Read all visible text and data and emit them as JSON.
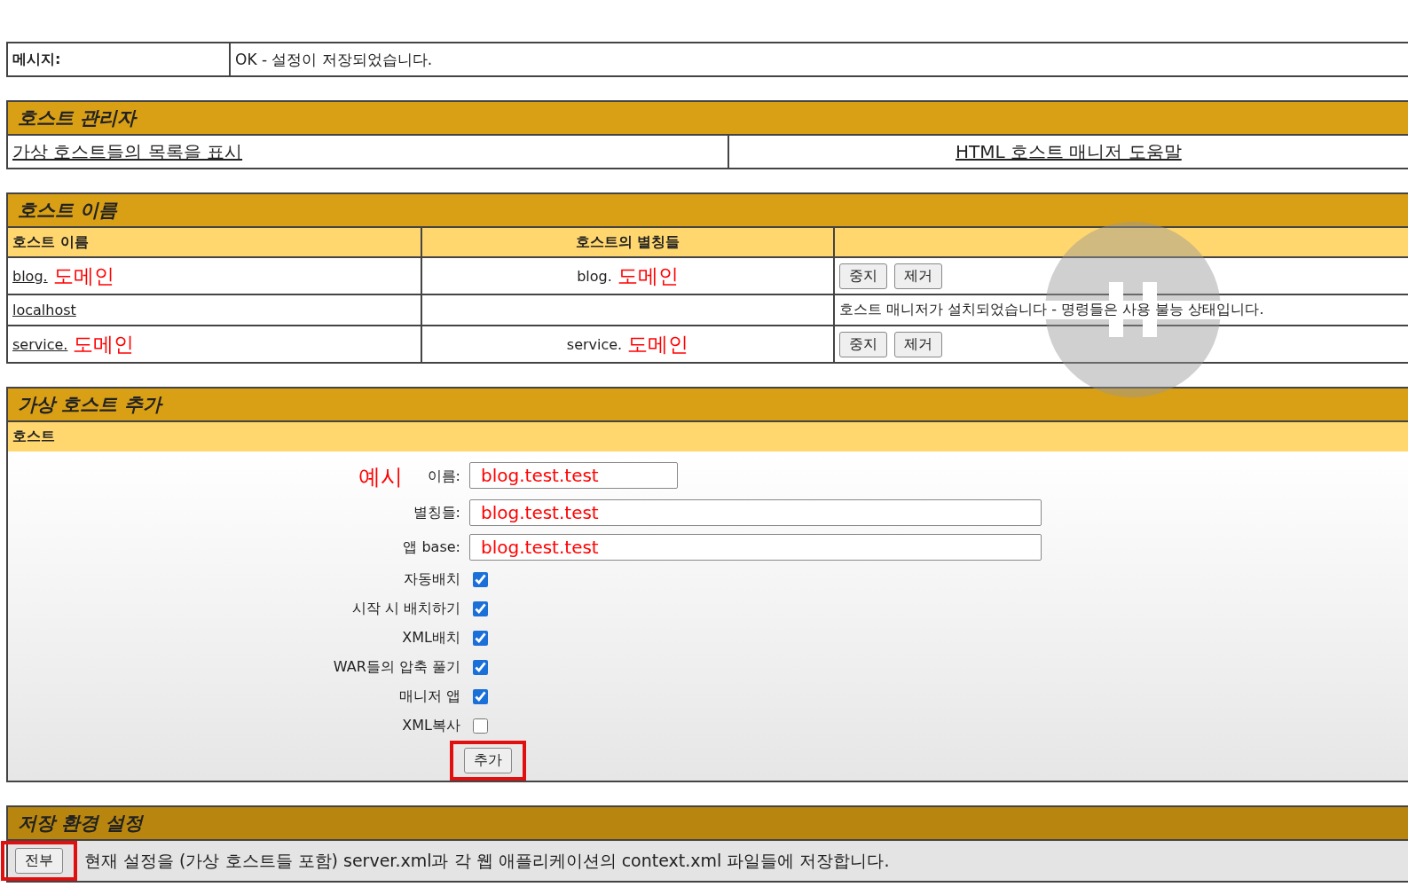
{
  "message": {
    "label": "메시지:",
    "text": "OK - 설정이 저장되었습니다."
  },
  "host_manager": {
    "title": "호스트 관리자",
    "links": [
      "가상 호스트들의 목록을 표시",
      "HTML 호스트 매니저 도움말"
    ]
  },
  "host_names": {
    "title": "호스트 이름",
    "columns": [
      "호스트 이름",
      "호스트의 별칭들"
    ],
    "rows": [
      {
        "kind": "buttons",
        "name": "blog.",
        "name_note": "도메인",
        "alias": "blog.",
        "alias_note": "도메인",
        "buttons": [
          "중지",
          "제거"
        ]
      },
      {
        "kind": "message",
        "name": "localhost",
        "message": "호스트 매니저가 설치되었습니다 - 명령들은 사용 불능 상태입니다."
      },
      {
        "kind": "buttons",
        "name": "service.",
        "name_note": "도메인",
        "alias": "service.",
        "alias_note": "도메인",
        "buttons": [
          "중지",
          "제거"
        ]
      }
    ]
  },
  "add_host": {
    "title": "가상 호스트 추가",
    "subheader": "호스트",
    "note": "예시",
    "fields": [
      {
        "kind": "short",
        "label": "이름:",
        "value": "blog.test.test"
      },
      {
        "kind": "long",
        "label": "별칭들:",
        "value": "blog.test.test"
      },
      {
        "kind": "long",
        "label": "앱 base:",
        "value": "blog.test.test"
      }
    ],
    "checkboxes": [
      {
        "label": "자동배치",
        "checked": true
      },
      {
        "label": "시작 시 배치하기",
        "checked": true
      },
      {
        "label": "XML배치",
        "checked": true
      },
      {
        "label": "WAR들의 압축 풀기",
        "checked": true
      },
      {
        "label": "매니저 앱",
        "checked": true
      },
      {
        "label": "XML복사",
        "checked": false
      }
    ],
    "button": {
      "label": "추가",
      "highlighted": true
    }
  },
  "persist": {
    "title": "저장 환경 설정",
    "button": {
      "label": "전부",
      "highlighted": true
    },
    "text": "현재 설정을 (가상 호스트들 포함) server.xml과 각 웹 애플리케이션의 context.xml 파일들에 저장합니다."
  },
  "player": {
    "paused": true
  }
}
